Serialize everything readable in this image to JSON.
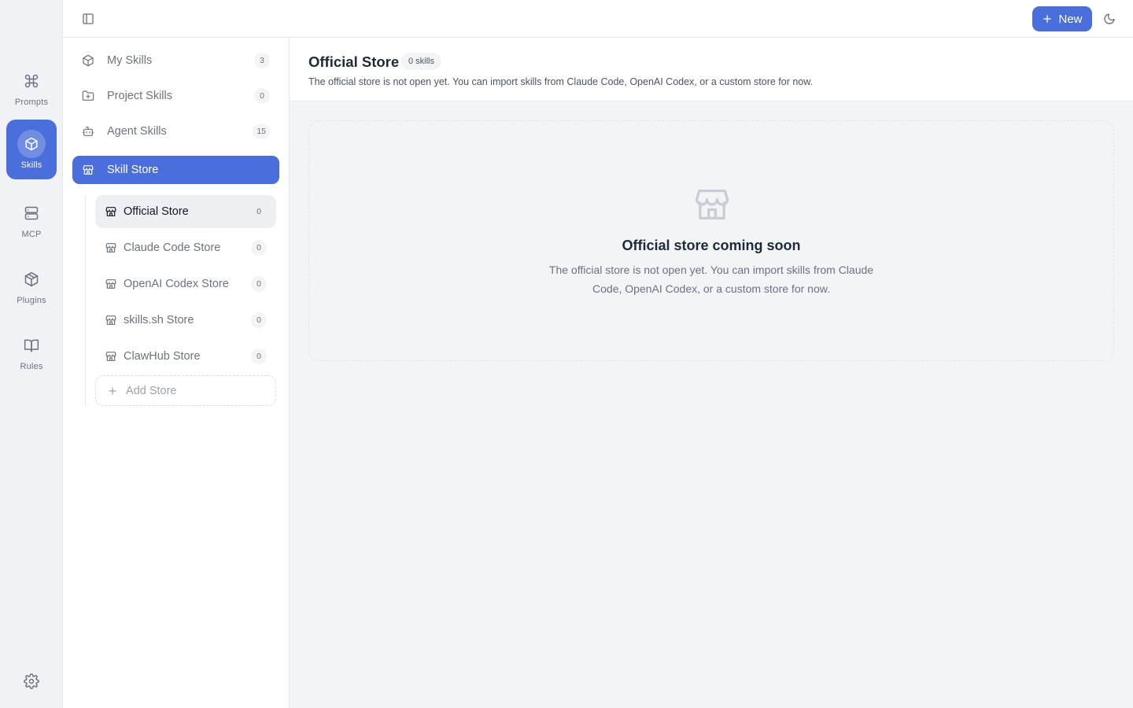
{
  "rail": {
    "items": [
      {
        "label": "Prompts",
        "icon": "command-icon"
      },
      {
        "label": "Skills",
        "icon": "cube-icon"
      },
      {
        "label": "MCP",
        "icon": "server-icon"
      },
      {
        "label": "Plugins",
        "icon": "package-icon"
      },
      {
        "label": "Rules",
        "icon": "book-icon"
      }
    ],
    "active": "Skills",
    "settings_icon": "gear-icon"
  },
  "topbar": {
    "new_label": "New",
    "accent": "#4a6fdc"
  },
  "sidebar": {
    "items": [
      {
        "label": "My Skills",
        "count": "3",
        "icon": "cube-icon"
      },
      {
        "label": "Project Skills",
        "count": "0",
        "icon": "folder-plus-icon"
      },
      {
        "label": "Agent Skills",
        "count": "15",
        "icon": "bot-icon"
      },
      {
        "label": "Skill Store",
        "icon": "store-icon"
      }
    ],
    "stores": [
      {
        "label": "Official Store",
        "count": "0"
      },
      {
        "label": "Claude Code Store",
        "count": "0"
      },
      {
        "label": "OpenAI Codex Store",
        "count": "0"
      },
      {
        "label": "skills.sh Store",
        "count": "0"
      },
      {
        "label": "ClawHub Store",
        "count": "0"
      }
    ],
    "add_store_label": "Add Store"
  },
  "main": {
    "title": "Official Store",
    "badge": "0 skills",
    "description": "The official store is not open yet. You can import skills from Claude Code, OpenAI Codex, or a custom store for now.",
    "empty_title": "Official store coming soon",
    "empty_description": "The official store is not open yet. You can import skills from Claude Code, OpenAI Codex, or a custom store for now."
  }
}
